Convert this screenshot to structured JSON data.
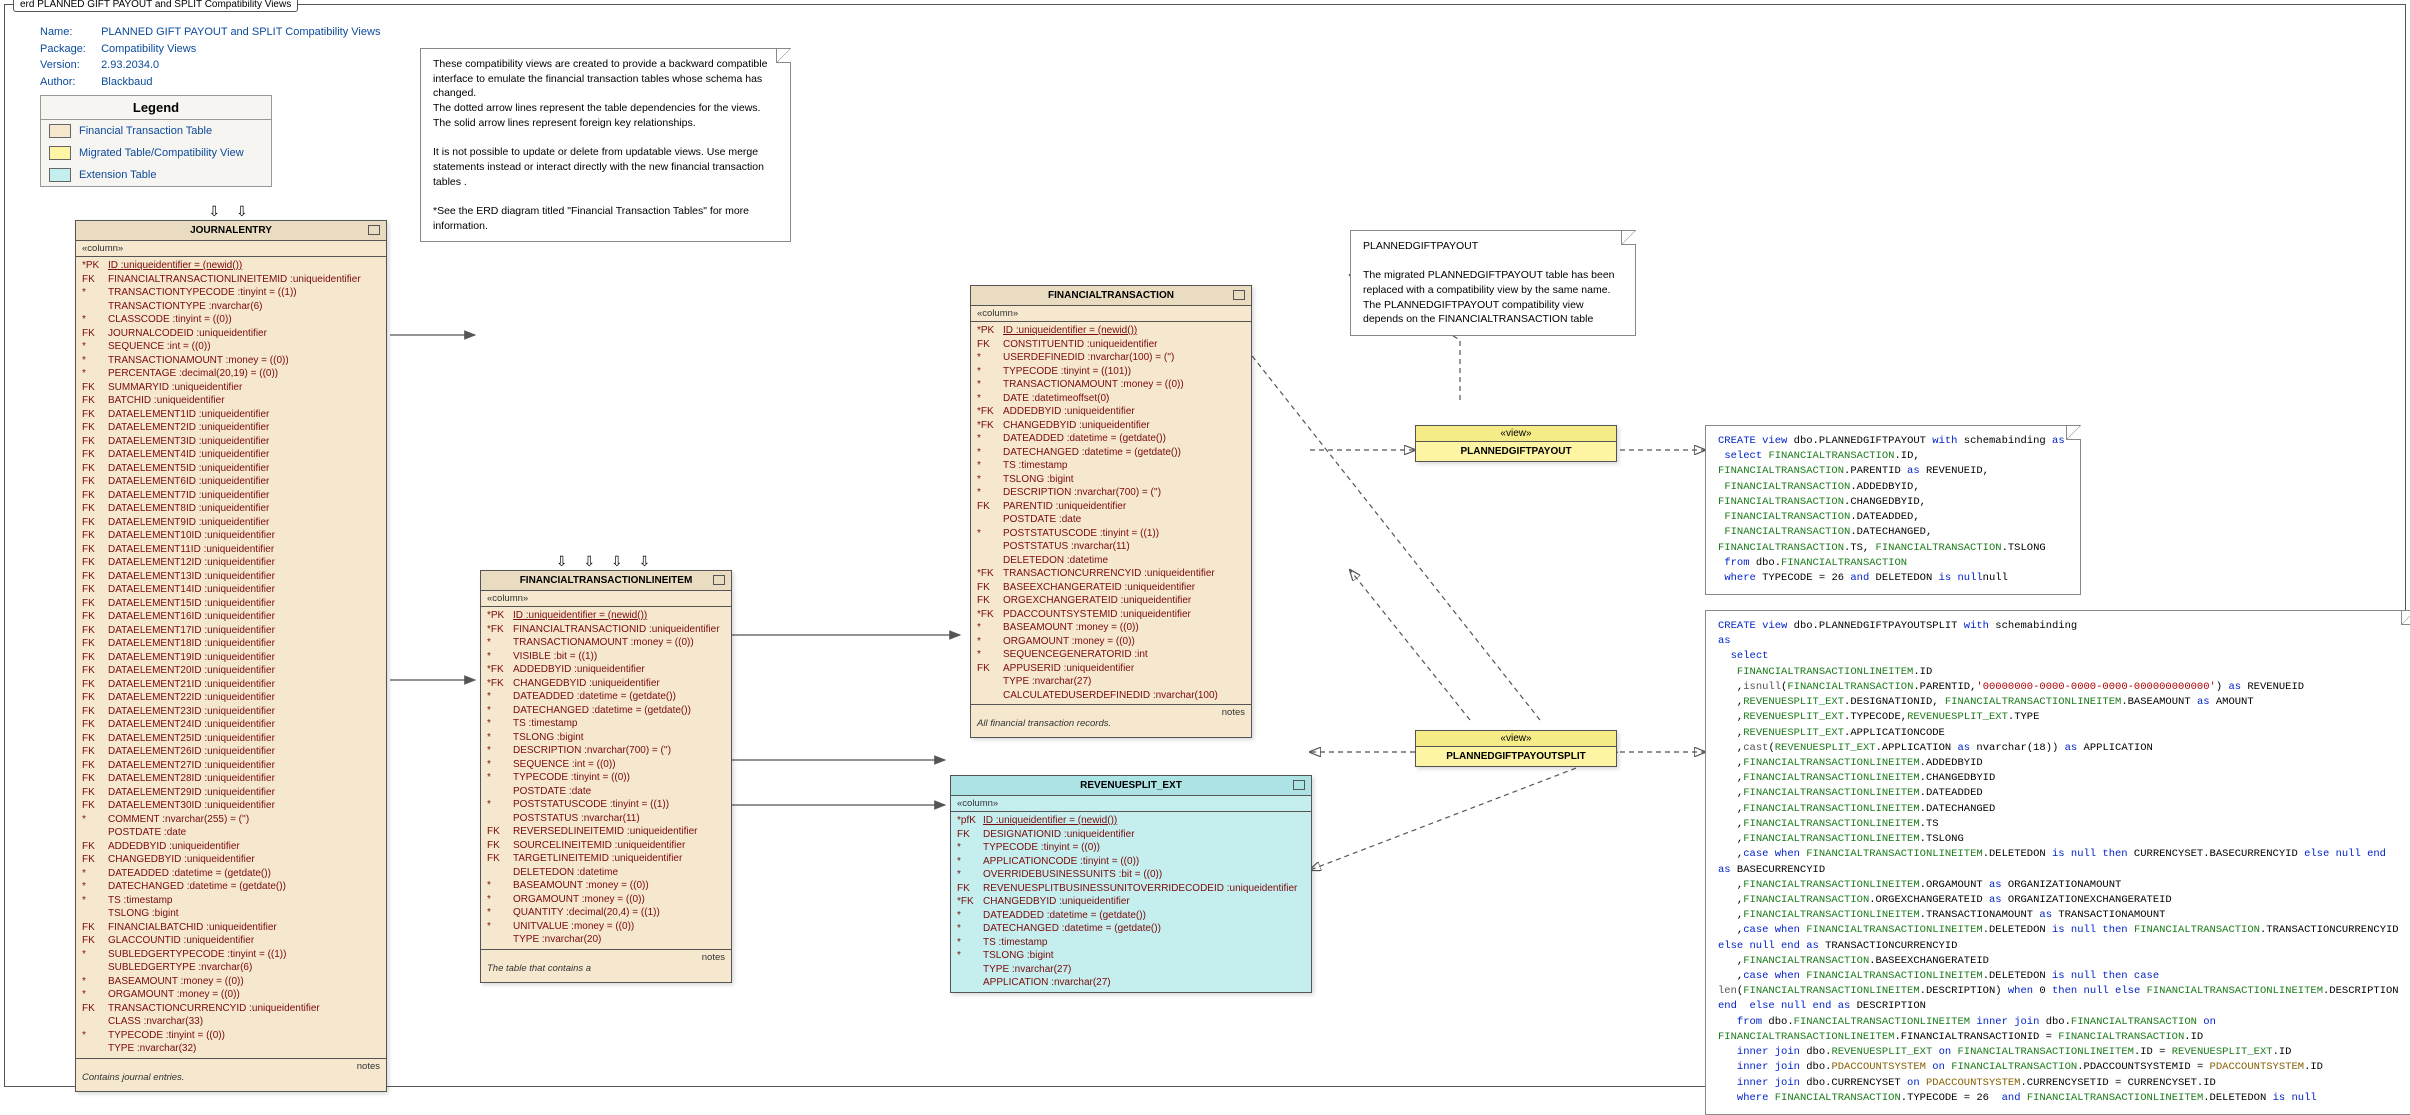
{
  "title": "erd PLANNED GIFT PAYOUT and SPLIT Compatibility Views",
  "meta": {
    "nameLabel": "Name:",
    "nameVal": "PLANNED GIFT PAYOUT and SPLIT Compatibility Views",
    "packageLabel": "Package:",
    "packageVal": "Compatibility Views",
    "versionLabel": "Version:",
    "versionVal": "2.93.2034.0",
    "authorLabel": "Author:",
    "authorVal": "Blackbaud"
  },
  "legend": {
    "title": "Legend",
    "items": [
      "Financial Transaction Table",
      "Migrated Table/Compatibility View",
      "Extension Table"
    ]
  },
  "noteMain": "These compatibility views are created to provide a backward compatible interface to emulate the financial transaction tables whose schema has changed.\nThe dotted arrow lines represent the table dependencies for the views. The solid arrow lines represent foreign key relationships.\n\nIt is not possible to update or delete from updatable views.  Use merge statements instead or interact directly with the new financial transaction tables .\n\n*See the ERD diagram titled \"Financial Transaction Tables\" for more information.",
  "notePGP": "PLANNEDGIFTPAYOUT\n\nThe migrated PLANNEDGIFTPAYOUT table has been replaced with a compatibility view by the same name.  The PLANNEDGIFTPAYOUT compatibility view depends on the FINANCIALTRANSACTION table",
  "journalentry": {
    "title": "JOURNALENTRY",
    "sec": "«column»",
    "cols": [
      [
        "*PK",
        "ID :uniqueidentifier = (newid())"
      ],
      [
        "FK",
        "FINANCIALTRANSACTIONLINEITEMID :uniqueidentifier"
      ],
      [
        "*",
        "TRANSACTIONTYPECODE :tinyint = ((1))"
      ],
      [
        "",
        "TRANSACTIONTYPE :nvarchar(6)"
      ],
      [
        "*",
        "CLASSCODE :tinyint = ((0))"
      ],
      [
        "FK",
        "JOURNALCODEID :uniqueidentifier"
      ],
      [
        "*",
        "SEQUENCE :int = ((0))"
      ],
      [
        "*",
        "TRANSACTIONAMOUNT :money = ((0))"
      ],
      [
        "*",
        "PERCENTAGE :decimal(20,19) = ((0))"
      ],
      [
        "FK",
        "SUMMARYID :uniqueidentifier"
      ],
      [
        "FK",
        "BATCHID :uniqueidentifier"
      ],
      [
        "FK",
        "DATAELEMENT1ID :uniqueidentifier"
      ],
      [
        "FK",
        "DATAELEMENT2ID :uniqueidentifier"
      ],
      [
        "FK",
        "DATAELEMENT3ID :uniqueidentifier"
      ],
      [
        "FK",
        "DATAELEMENT4ID :uniqueidentifier"
      ],
      [
        "FK",
        "DATAELEMENT5ID :uniqueidentifier"
      ],
      [
        "FK",
        "DATAELEMENT6ID :uniqueidentifier"
      ],
      [
        "FK",
        "DATAELEMENT7ID :uniqueidentifier"
      ],
      [
        "FK",
        "DATAELEMENT8ID :uniqueidentifier"
      ],
      [
        "FK",
        "DATAELEMENT9ID :uniqueidentifier"
      ],
      [
        "FK",
        "DATAELEMENT10ID :uniqueidentifier"
      ],
      [
        "FK",
        "DATAELEMENT11ID :uniqueidentifier"
      ],
      [
        "FK",
        "DATAELEMENT12ID :uniqueidentifier"
      ],
      [
        "FK",
        "DATAELEMENT13ID :uniqueidentifier"
      ],
      [
        "FK",
        "DATAELEMENT14ID :uniqueidentifier"
      ],
      [
        "FK",
        "DATAELEMENT15ID :uniqueidentifier"
      ],
      [
        "FK",
        "DATAELEMENT16ID :uniqueidentifier"
      ],
      [
        "FK",
        "DATAELEMENT17ID :uniqueidentifier"
      ],
      [
        "FK",
        "DATAELEMENT18ID :uniqueidentifier"
      ],
      [
        "FK",
        "DATAELEMENT19ID :uniqueidentifier"
      ],
      [
        "FK",
        "DATAELEMENT20ID :uniqueidentifier"
      ],
      [
        "FK",
        "DATAELEMENT21ID :uniqueidentifier"
      ],
      [
        "FK",
        "DATAELEMENT22ID :uniqueidentifier"
      ],
      [
        "FK",
        "DATAELEMENT23ID :uniqueidentifier"
      ],
      [
        "FK",
        "DATAELEMENT24ID :uniqueidentifier"
      ],
      [
        "FK",
        "DATAELEMENT25ID :uniqueidentifier"
      ],
      [
        "FK",
        "DATAELEMENT26ID :uniqueidentifier"
      ],
      [
        "FK",
        "DATAELEMENT27ID :uniqueidentifier"
      ],
      [
        "FK",
        "DATAELEMENT28ID :uniqueidentifier"
      ],
      [
        "FK",
        "DATAELEMENT29ID :uniqueidentifier"
      ],
      [
        "FK",
        "DATAELEMENT30ID :uniqueidentifier"
      ],
      [
        "*",
        "COMMENT :nvarchar(255) = ('')"
      ],
      [
        "",
        "POSTDATE :date"
      ],
      [
        "FK",
        "ADDEDBYID :uniqueidentifier"
      ],
      [
        "FK",
        "CHANGEDBYID :uniqueidentifier"
      ],
      [
        "*",
        "DATEADDED :datetime = (getdate())"
      ],
      [
        "*",
        "DATECHANGED :datetime = (getdate())"
      ],
      [
        "*",
        "TS :timestamp"
      ],
      [
        "",
        "TSLONG :bigint"
      ],
      [
        "FK",
        "FINANCIALBATCHID :uniqueidentifier"
      ],
      [
        "FK",
        "GLACCOUNTID :uniqueidentifier"
      ],
      [
        "*",
        "SUBLEDGERTYPECODE :tinyint = ((1))"
      ],
      [
        "",
        "SUBLEDGERTYPE :nvarchar(6)"
      ],
      [
        "*",
        "BASEAMOUNT :money = ((0))"
      ],
      [
        "*",
        "ORGAMOUNT :money = ((0))"
      ],
      [
        "FK",
        "TRANSACTIONCURRENCYID :uniqueidentifier"
      ],
      [
        "",
        "CLASS :nvarchar(33)"
      ],
      [
        "*",
        "TYPECODE :tinyint = ((0))"
      ],
      [
        "",
        "TYPE :nvarchar(32)"
      ]
    ],
    "notesLabel": "notes",
    "notes": "Contains journal entries."
  },
  "ftli": {
    "title": "FINANCIALTRANSACTIONLINEITEM",
    "sec": "«column»",
    "cols": [
      [
        "*PK",
        "ID :uniqueidentifier = (newid())"
      ],
      [
        "*FK",
        "FINANCIALTRANSACTIONID :uniqueidentifier"
      ],
      [
        "*",
        "TRANSACTIONAMOUNT :money = ((0))"
      ],
      [
        "*",
        "VISIBLE :bit = ((1))"
      ],
      [
        "*FK",
        "ADDEDBYID :uniqueidentifier"
      ],
      [
        "*FK",
        "CHANGEDBYID :uniqueidentifier"
      ],
      [
        "*",
        "DATEADDED :datetime = (getdate())"
      ],
      [
        "*",
        "DATECHANGED :datetime = (getdate())"
      ],
      [
        "*",
        "TS :timestamp"
      ],
      [
        "*",
        "TSLONG :bigint"
      ],
      [
        "*",
        "DESCRIPTION :nvarchar(700) = ('')"
      ],
      [
        "*",
        "SEQUENCE :int = ((0))"
      ],
      [
        "*",
        "TYPECODE :tinyint = ((0))"
      ],
      [
        "",
        "POSTDATE :date"
      ],
      [
        "*",
        "POSTSTATUSCODE :tinyint = ((1))"
      ],
      [
        "",
        "POSTSTATUS :nvarchar(11)"
      ],
      [
        "FK",
        "REVERSEDLINEITEMID :uniqueidentifier"
      ],
      [
        "FK",
        "SOURCELINEITEMID :uniqueidentifier"
      ],
      [
        "FK",
        "TARGETLINEITEMID :uniqueidentifier"
      ],
      [
        "",
        "DELETEDON :datetime"
      ],
      [
        "*",
        "BASEAMOUNT :money = ((0))"
      ],
      [
        "*",
        "ORGAMOUNT :money = ((0))"
      ],
      [
        "*",
        "QUANTITY :decimal(20,4) = ((1))"
      ],
      [
        "*",
        "UNITVALUE :money = ((0))"
      ],
      [
        "",
        "TYPE :nvarchar(20)"
      ]
    ],
    "notesLabel": "notes",
    "notes": "The table that contains a"
  },
  "ft": {
    "title": "FINANCIALTRANSACTION",
    "sec": "«column»",
    "cols": [
      [
        "*PK",
        "ID :uniqueidentifier = (newid())"
      ],
      [
        "FK",
        "CONSTITUENTID :uniqueidentifier"
      ],
      [
        "*",
        "USERDEFINEDID :nvarchar(100) = ('')"
      ],
      [
        "*",
        "TYPECODE :tinyint = ((101))"
      ],
      [
        "*",
        "TRANSACTIONAMOUNT :money = ((0))"
      ],
      [
        "*",
        "DATE :datetimeoffset(0)"
      ],
      [
        "*FK",
        "ADDEDBYID :uniqueidentifier"
      ],
      [
        "*FK",
        "CHANGEDBYID :uniqueidentifier"
      ],
      [
        "*",
        "DATEADDED :datetime = (getdate())"
      ],
      [
        "*",
        "DATECHANGED :datetime = (getdate())"
      ],
      [
        "*",
        "TS :timestamp"
      ],
      [
        "*",
        "TSLONG :bigint"
      ],
      [
        "*",
        "DESCRIPTION :nvarchar(700) = ('')"
      ],
      [
        "FK",
        "PARENTID :uniqueidentifier"
      ],
      [
        "",
        "POSTDATE :date"
      ],
      [
        "*",
        "POSTSTATUSCODE :tinyint = ((1))"
      ],
      [
        "",
        "POSTSTATUS :nvarchar(11)"
      ],
      [
        "",
        "DELETEDON :datetime"
      ],
      [
        "*FK",
        "TRANSACTIONCURRENCYID :uniqueidentifier"
      ],
      [
        "FK",
        "BASEEXCHANGERATEID :uniqueidentifier"
      ],
      [
        "FK",
        "ORGEXCHANGERATEID :uniqueidentifier"
      ],
      [
        "*FK",
        "PDACCOUNTSYSTEMID :uniqueidentifier"
      ],
      [
        "*",
        "BASEAMOUNT :money = ((0))"
      ],
      [
        "*",
        "ORGAMOUNT :money = ((0))"
      ],
      [
        "*",
        "SEQUENCEGENERATORID :int"
      ],
      [
        "FK",
        "APPUSERID :uniqueidentifier"
      ],
      [
        "",
        "TYPE :nvarchar(27)"
      ],
      [
        "",
        "CALCULATEDUSERDEFINEDID :nvarchar(100)"
      ]
    ],
    "notesLabel": "notes",
    "notes": "All financial transaction records."
  },
  "rse": {
    "title": "REVENUESPLIT_EXT",
    "sec": "«column»",
    "cols": [
      [
        "*pfK",
        "ID :uniqueidentifier = (newid())"
      ],
      [
        "FK",
        "DESIGNATIONID :uniqueidentifier"
      ],
      [
        "*",
        "TYPECODE :tinyint = ((0))"
      ],
      [
        "*",
        "APPLICATIONCODE :tinyint = ((0))"
      ],
      [
        "*",
        "OVERRIDEBUSINESSUNITS :bit = ((0))"
      ],
      [
        "FK",
        "REVENUESPLITBUSINESSUNITOVERRIDECODEID :uniqueidentifier"
      ],
      [
        "*FK",
        "CHANGEDBYID :uniqueidentifier"
      ],
      [
        "*",
        "DATEADDED :datetime = (getdate())"
      ],
      [
        "*",
        "DATECHANGED :datetime = (getdate())"
      ],
      [
        "*",
        "TS :timestamp"
      ],
      [
        "*",
        "TSLONG :bigint"
      ],
      [
        "",
        "TYPE :nvarchar(27)"
      ],
      [
        "",
        "APPLICATION :nvarchar(27)"
      ]
    ]
  },
  "views": {
    "vlabel": "«view»",
    "pgp": "PLANNEDGIFTPAYOUT",
    "pgps": "PLANNEDGIFTPAYOUTSPLIT"
  }
}
